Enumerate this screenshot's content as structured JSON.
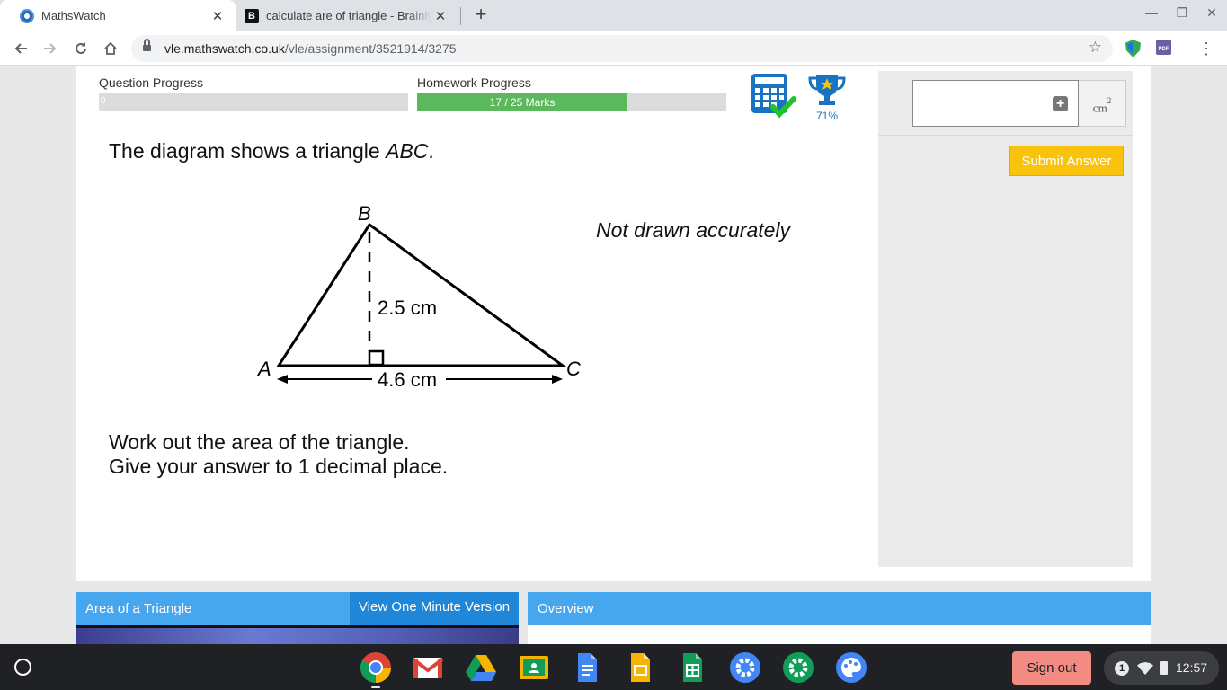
{
  "browser": {
    "tabs": [
      {
        "title": "MathsWatch",
        "active": true,
        "favicon": "mathswatch-icon"
      },
      {
        "title": "calculate are of triangle - Brainly.com",
        "active": false,
        "favicon": "brainly-icon",
        "favicon_letter": "B"
      }
    ],
    "new_tab_symbol": "+",
    "close_symbol": "✕",
    "window_controls": {
      "minimize": "—",
      "restore": "❐",
      "close": "✕"
    },
    "url_host": "vle.mathswatch.co.uk",
    "url_path": "/vle/assignment/3521914/3275",
    "pdf_extension_label": "PDF"
  },
  "progress": {
    "question_label": "Question Progress",
    "question_value_text": "0",
    "question_fraction": 0,
    "homework_label": "Homework Progress",
    "homework_text": "17 / 25 Marks",
    "homework_fraction": 0.68
  },
  "trophy": {
    "percent": "71%"
  },
  "question": {
    "intro_prefix": "The diagram shows a triangle ",
    "intro_italic": "ABC",
    "intro_suffix": ".",
    "note": "Not drawn accurately",
    "vertex_a": "A",
    "vertex_b": "B",
    "vertex_c": "C",
    "height_label": "2.5 cm",
    "base_label": "4.6 cm",
    "instruction_1": "Work out the area of the triangle.",
    "instruction_2": "Give your answer to 1 decimal place."
  },
  "answer": {
    "value": "",
    "plus_symbol": "+",
    "unit": "cm",
    "unit_power": "2",
    "submit_label": "Submit Answer"
  },
  "video": {
    "title": "Area of a Triangle",
    "one_minute_label": "View One Minute Version"
  },
  "overview": {
    "title": "Overview"
  },
  "shelf": {
    "apps": [
      "chrome-icon",
      "gmail-icon",
      "drive-icon",
      "classroom-icon",
      "docs-icon",
      "slides-icon",
      "sheets-icon",
      "settings-icon",
      "settings-alt-icon",
      "canvas-icon"
    ],
    "sign_out_label": "Sign out",
    "notification_count": "1",
    "time": "12:57"
  },
  "colors": {
    "progress_green": "#5cb85c",
    "submit_yellow": "#f9c20b",
    "header_blue": "#46a6ee",
    "button_blue": "#1f86d8",
    "sign_out_red": "#f28b82",
    "icon_blue": "#1a73c0"
  }
}
